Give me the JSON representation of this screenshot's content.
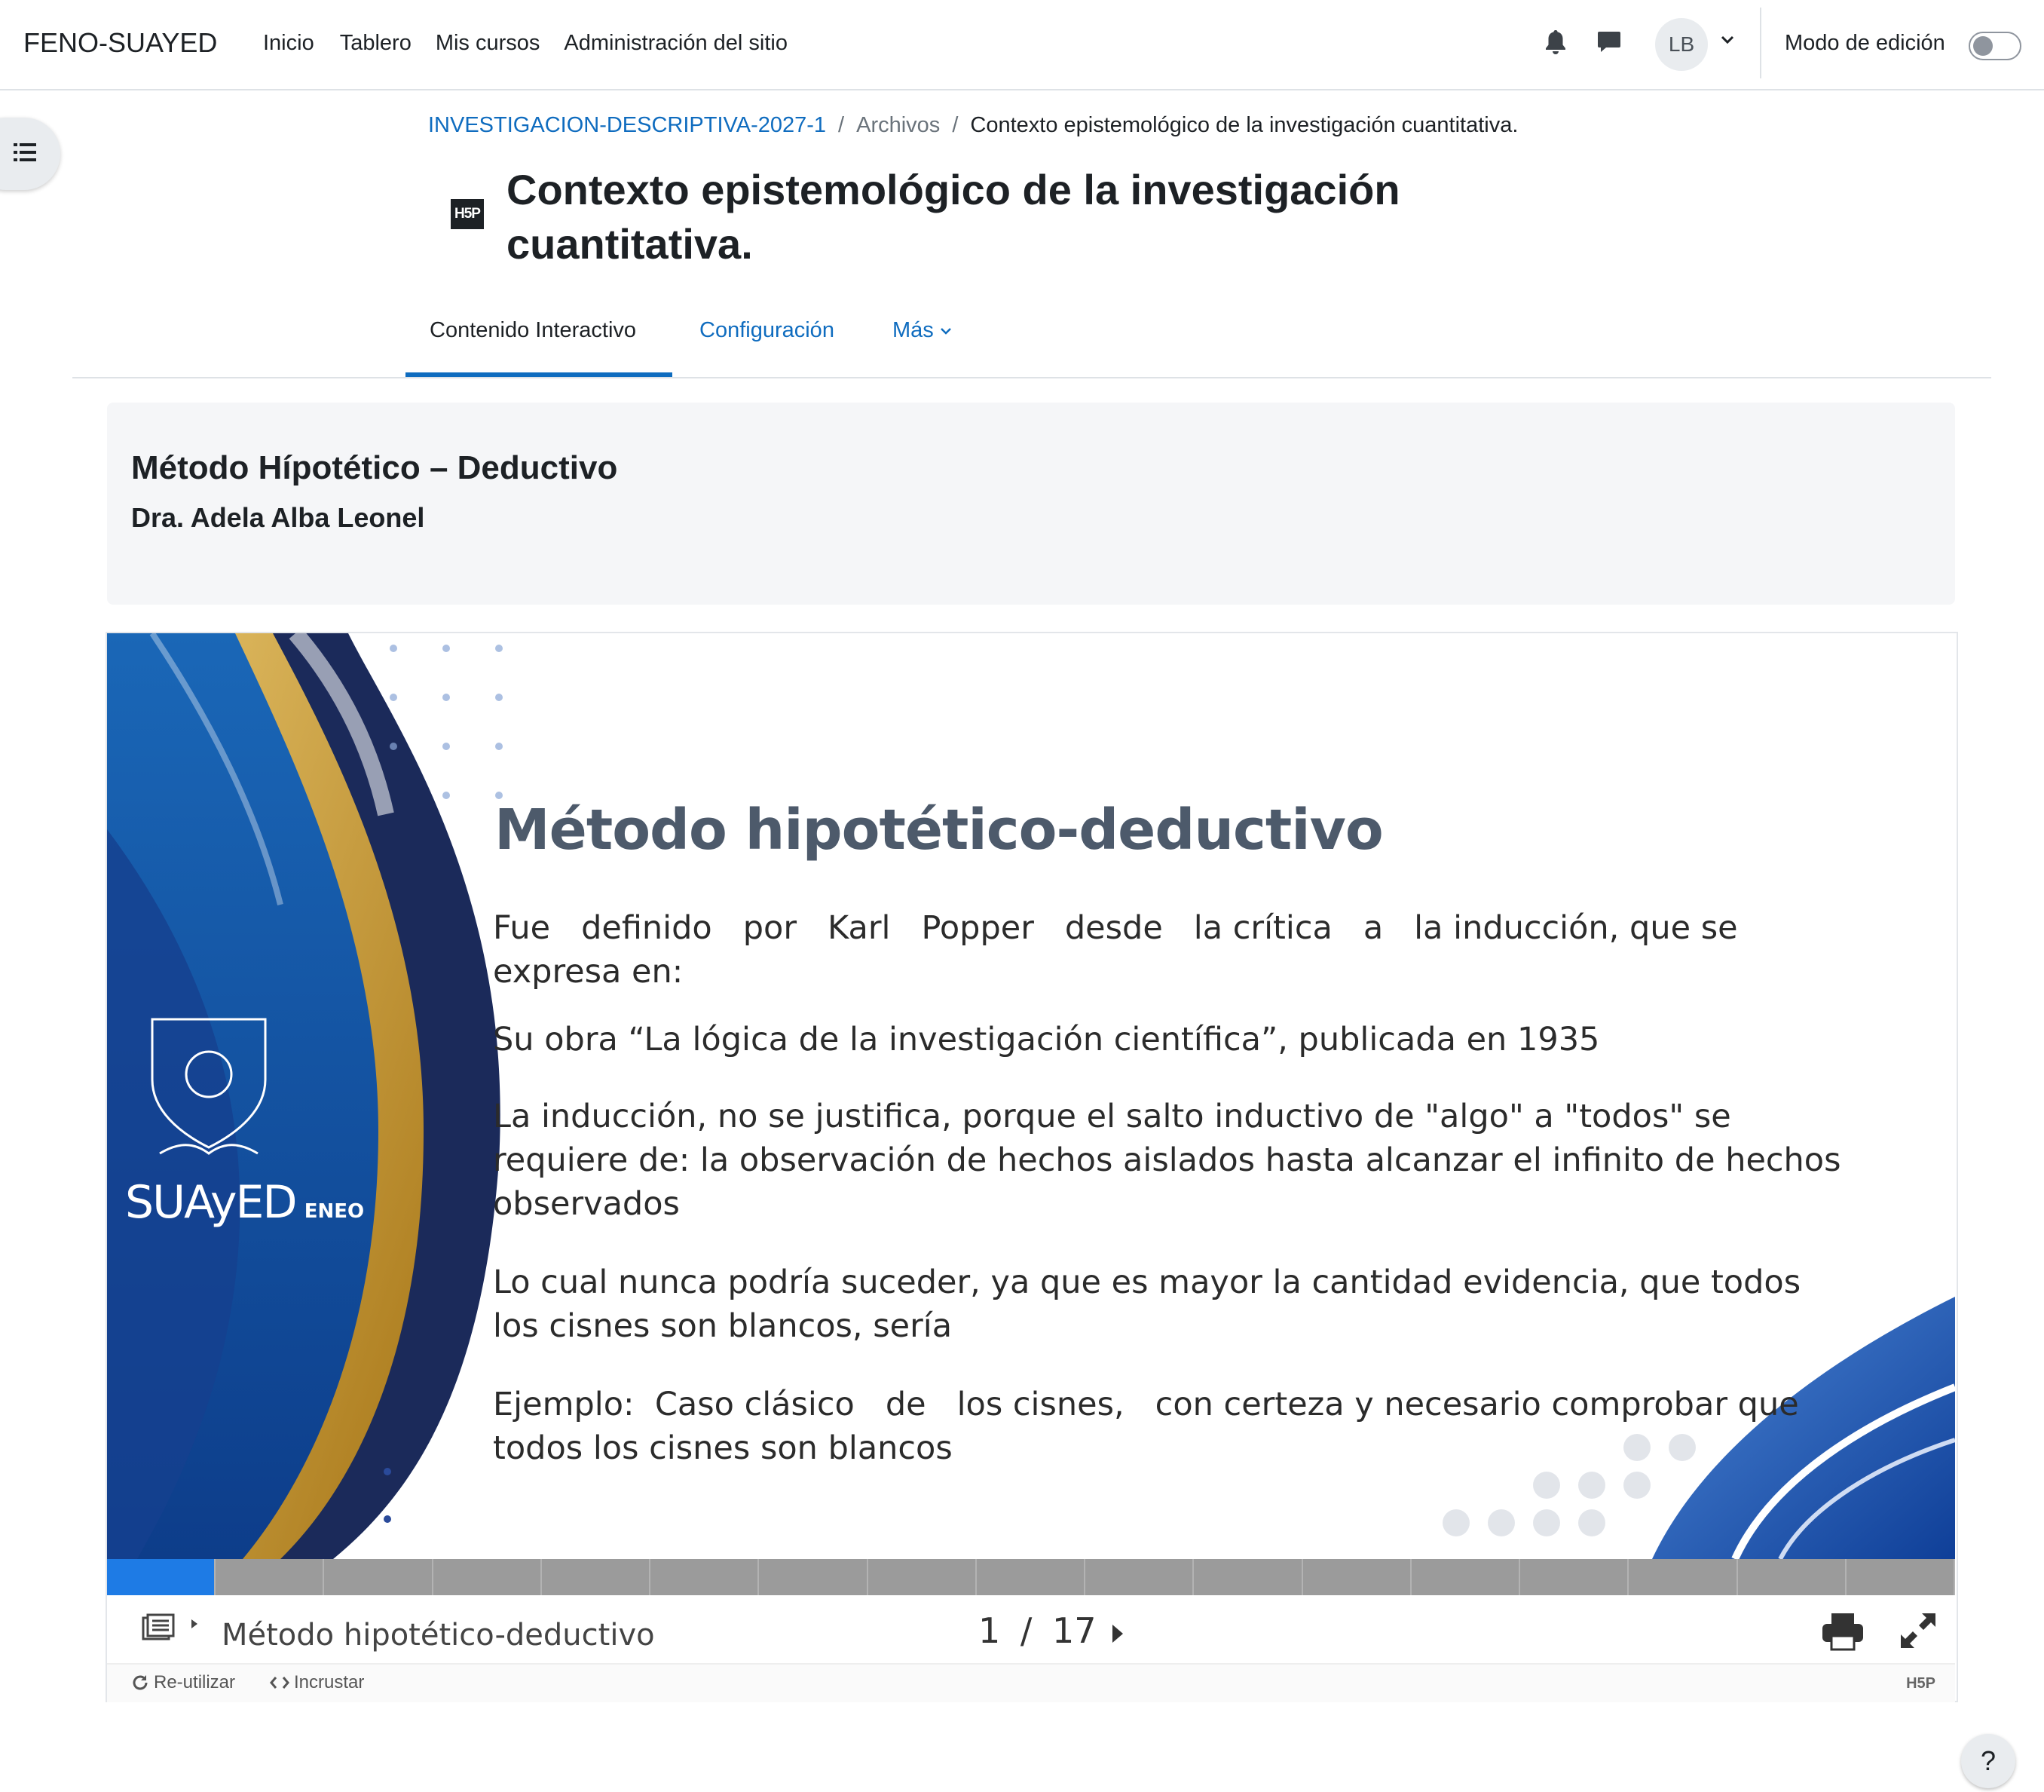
{
  "navbar": {
    "brand": "FENO-SUAYED",
    "links": [
      "Inicio",
      "Tablero",
      "Mis cursos",
      "Administración del sitio"
    ],
    "avatar_initials": "LB",
    "edit_mode_label": "Modo de edición",
    "edit_mode_on": false
  },
  "breadcrumb": {
    "course": "INVESTIGACION-DESCRIPTIVA-2027-1",
    "section": "Archivos",
    "current": "Contexto epistemológico de la investigación cuantitativa.",
    "separator": "/"
  },
  "page": {
    "icon_label": "H5P",
    "title": "Contexto epistemológico de la investigación cuantitativa."
  },
  "tabs": {
    "items": [
      "Contenido Interactivo",
      "Configuración",
      "Más"
    ],
    "active": "Contenido Interactivo"
  },
  "intro": {
    "title": "Método Hípotético – Deductivo",
    "author": "Dra. Adela Alba Leonel"
  },
  "slide": {
    "title": "Método hipotético-deductivo",
    "intro_line1": "Fue   definido   por   Karl   Popper   desde   la crítica   a   la inducción, que se",
    "intro_line2": "expresa en:",
    "p1": "Su obra “La lógica de la investigación científica”, publicada en 1935",
    "p2_line1": "La inducción, no se justifica, porque el salto inductivo de \"algo\" a \"todos\" se",
    "p2_line2": "requiere de: la observación de hechos aislados hasta alcanzar el infinito de hechos",
    "p2_line3": "observados",
    "p3_line1": "Lo cual nunca podría suceder, ya que es mayor la cantidad evidencia, que todos",
    "p3_line2": "los cisnes son blancos, sería",
    "p4_line1": "Ejemplo:  Caso clásico   de   los cisnes,   con certeza y necesario comprobar que",
    "p4_line2": "todos los cisnes son blancos",
    "logo_text": "SUAyED",
    "logo_sub": "ENEO"
  },
  "player": {
    "slide_title": "Método hipotético-deductivo",
    "current": "1",
    "separator": "/",
    "total": "17",
    "progress_fraction": 0.0588,
    "progress_color": "#1e7be5"
  },
  "actions": {
    "reuse": "Re-utilizar",
    "embed": "Incrustar",
    "h5p_mark": "H5P"
  },
  "help": "?",
  "colors": {
    "link": "#0f6cbf",
    "text": "#1d2125",
    "slide_navy": "#1b2a5a",
    "slide_gold": "#c69a2a"
  }
}
